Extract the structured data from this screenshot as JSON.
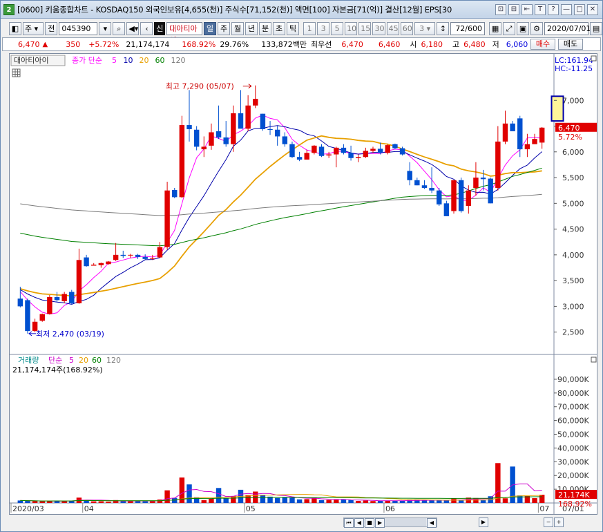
{
  "window": {
    "app_number": "2",
    "title": "[0600] 키움종합차트 - KOSDAQ150 외국인보유[4,655(천)] 주식수[71,152(천)] 액면[100] 자본금[71(억)] 결산[12월] EPS[30"
  },
  "title_buttons": [
    "⊡",
    "⊟",
    "⇤",
    "T",
    "?",
    "—",
    "□",
    "✕"
  ],
  "toolbar": {
    "period_sel": "주",
    "jeon_btn": "전",
    "code": "045390",
    "shin_label": "신",
    "stock_name": "대아티아이",
    "intervals": [
      "일",
      "주",
      "월",
      "년",
      "분",
      "초",
      "틱"
    ],
    "selected_interval": "일",
    "numbers": [
      "1",
      "3",
      "5",
      "10",
      "15",
      "30",
      "45",
      "60"
    ],
    "custom_num": "3",
    "view_count": "72/600",
    "date": "2020/07/01"
  },
  "infobar": {
    "price": "6,470",
    "change": "350",
    "change_pct": "+5.72%",
    "volume": "21,174,174",
    "volume_pct": "168.92%",
    "turnover": "29.76%",
    "amount": "133,872백만",
    "best_label": "최우선",
    "ask": "6,470",
    "bid": "6,460",
    "low_label_si": "시",
    "open": "6,180",
    "high_label": "고",
    "high": "6,480",
    "low_label": "저",
    "low": "6,060",
    "buy_btn": "매수",
    "sell_btn": "매도"
  },
  "price_panel": {
    "stock_tag": "대아티아이",
    "ma_label": "종가 단순",
    "ma_periods": [
      "5",
      "10",
      "20",
      "60",
      "120"
    ],
    "ma_colors": [
      "#ff00ff",
      "#0000aa",
      "#e8a000",
      "#008000",
      "#7a7a7a"
    ],
    "lc": "LC:161.94",
    "hc": "HC:-11.25",
    "current_price_tag": "6,470",
    "current_pct_tag": "5.72%",
    "high_annotation": "최고 7,290 (05/07)",
    "low_annotation": "최저 2,470 (03/19)"
  },
  "volume_panel": {
    "label": "거래량",
    "ma_label": "단순",
    "ma_periods": [
      "5",
      "20",
      "60",
      "120"
    ],
    "ma_colors": [
      "#cc00cc",
      "#e8a000",
      "#008000",
      "#7a7a7a"
    ],
    "current_text": "21,174,174주(168.92%)",
    "current_tag": "21,174K",
    "current_pct_tag": "168.92%"
  },
  "x_axis": {
    "labels": [
      "2020/03",
      "04",
      "05",
      "06",
      "07"
    ],
    "right_label": "07/01"
  },
  "colors": {
    "up": "#e00000",
    "down": "#0050d0",
    "panel_bg": "#ffffff"
  },
  "chart_data": {
    "type": "candlestick",
    "price_axis": {
      "min": 2200,
      "max": 7500,
      "ticks": [
        "2,500",
        "3,000",
        "3,500",
        "4,000",
        "4,500",
        "5,000",
        "5,500",
        "6,000",
        "6,500",
        "7,000"
      ]
    },
    "volume_axis": {
      "min": 0,
      "max": 98000,
      "ticks": [
        "10,000K",
        "20,000K",
        "30,000K",
        "40,000K",
        "50,000K",
        "60,000K",
        "70,000K",
        "80,000K",
        "90,000K"
      ]
    },
    "candles": [
      [
        3150,
        3380,
        2980,
        3000
      ],
      [
        3120,
        3150,
        2470,
        2520
      ],
      [
        2520,
        2760,
        2500,
        2700
      ],
      [
        2720,
        2860,
        2700,
        2850
      ],
      [
        2850,
        3220,
        2840,
        3180
      ],
      [
        3180,
        3280,
        3080,
        3120
      ],
      [
        3100,
        3280,
        3060,
        3240
      ],
      [
        3280,
        3320,
        3040,
        3060
      ],
      [
        3060,
        4120,
        3050,
        3900
      ],
      [
        3950,
        4000,
        3770,
        3780
      ],
      [
        3790,
        3840,
        3790,
        3810
      ],
      [
        3800,
        3850,
        3750,
        3840
      ],
      [
        3820,
        3880,
        3810,
        3870
      ],
      [
        3900,
        4230,
        3880,
        4000
      ],
      [
        4000,
        4080,
        3940,
        3980
      ],
      [
        3990,
        4020,
        3940,
        4000
      ],
      [
        4000,
        4020,
        3920,
        3960
      ],
      [
        3960,
        4010,
        3900,
        3920
      ],
      [
        3920,
        4000,
        3900,
        3930
      ],
      [
        3950,
        4250,
        3940,
        4150
      ],
      [
        4150,
        5420,
        4100,
        5250
      ],
      [
        5260,
        5300,
        5100,
        5120
      ],
      [
        5120,
        6700,
        5100,
        6520
      ],
      [
        6520,
        7200,
        6200,
        6440
      ],
      [
        6430,
        6500,
        6030,
        6100
      ],
      [
        6050,
        6300,
        5900,
        6100
      ],
      [
        6120,
        6550,
        6040,
        6380
      ],
      [
        6400,
        6900,
        6250,
        6280
      ],
      [
        6280,
        6600,
        6100,
        6150
      ],
      [
        6150,
        6900,
        6000,
        6750
      ],
      [
        6750,
        7200,
        6500,
        6450
      ],
      [
        6450,
        7100,
        6400,
        6900
      ],
      [
        6900,
        7290,
        6850,
        7030
      ],
      [
        6740,
        6740,
        6410,
        6440
      ],
      [
        6440,
        6600,
        6330,
        6430
      ],
      [
        6430,
        6500,
        6120,
        6300
      ],
      [
        6300,
        6380,
        6100,
        6150
      ],
      [
        6150,
        6200,
        5880,
        5900
      ],
      [
        5900,
        6000,
        5820,
        5850
      ],
      [
        5850,
        6040,
        5850,
        5980
      ],
      [
        5980,
        6130,
        5950,
        6120
      ],
      [
        6100,
        6150,
        5900,
        5920
      ],
      [
        5930,
        6000,
        5880,
        5950
      ],
      [
        5950,
        6100,
        5700,
        6080
      ],
      [
        6080,
        6150,
        5950,
        5980
      ],
      [
        5980,
        6120,
        5830,
        5880
      ],
      [
        5880,
        5950,
        5800,
        5900
      ],
      [
        5900,
        6080,
        5880,
        6020
      ],
      [
        6020,
        6100,
        5980,
        6060
      ],
      [
        6060,
        6180,
        5950,
        5980
      ],
      [
        5980,
        6150,
        5950,
        6130
      ],
      [
        6150,
        6160,
        6050,
        6070
      ],
      [
        6070,
        6100,
        5930,
        5950
      ],
      [
        5630,
        5800,
        5350,
        5450
      ],
      [
        5450,
        5500,
        5350,
        5350
      ],
      [
        5350,
        5450,
        5280,
        5300
      ],
      [
        5300,
        5700,
        5200,
        5250
      ],
      [
        5250,
        5300,
        4950,
        4980
      ],
      [
        5000,
        5050,
        4750,
        4750
      ],
      [
        4850,
        5450,
        4800,
        5450
      ],
      [
        5450,
        5500,
        4820,
        4850
      ],
      [
        4950,
        5350,
        4800,
        5250
      ],
      [
        5300,
        5800,
        5150,
        5500
      ],
      [
        5500,
        5650,
        5250,
        5470
      ],
      [
        5480,
        5500,
        5000,
        5000
      ],
      [
        5300,
        6500,
        5250,
        6200
      ],
      [
        6200,
        6800,
        6150,
        6550
      ],
      [
        6550,
        6600,
        6400,
        6400
      ],
      [
        6650,
        6700,
        5900,
        6050
      ],
      [
        6050,
        6350,
        5900,
        6150
      ],
      [
        6150,
        6350,
        6150,
        6250
      ],
      [
        6180,
        6480,
        6060,
        6470
      ]
    ],
    "volume_k": [
      1800,
      1600,
      1300,
      1200,
      1400,
      1600,
      1300,
      1700,
      3900,
      2200,
      1200,
      1200,
      900,
      2100,
      1500,
      1400,
      1300,
      1200,
      1400,
      2500,
      9200,
      3700,
      18500,
      13500,
      4200,
      2000,
      3100,
      10900,
      3300,
      5000,
      9600,
      5800,
      8300,
      6000,
      4600,
      3600,
      4400,
      3900,
      2600,
      2800,
      4000,
      2100,
      2200,
      2300,
      2500,
      2200,
      1500,
      1800,
      1400,
      1500,
      1800,
      1700,
      1700,
      2100,
      2300,
      2100,
      1800,
      1900,
      1800,
      3500,
      2000,
      3900,
      3600,
      2100,
      4900,
      29000,
      3400,
      26500,
      5500,
      5000,
      3500,
      6000
    ],
    "projected_box": {
      "low": 6600,
      "high": 7080
    }
  }
}
